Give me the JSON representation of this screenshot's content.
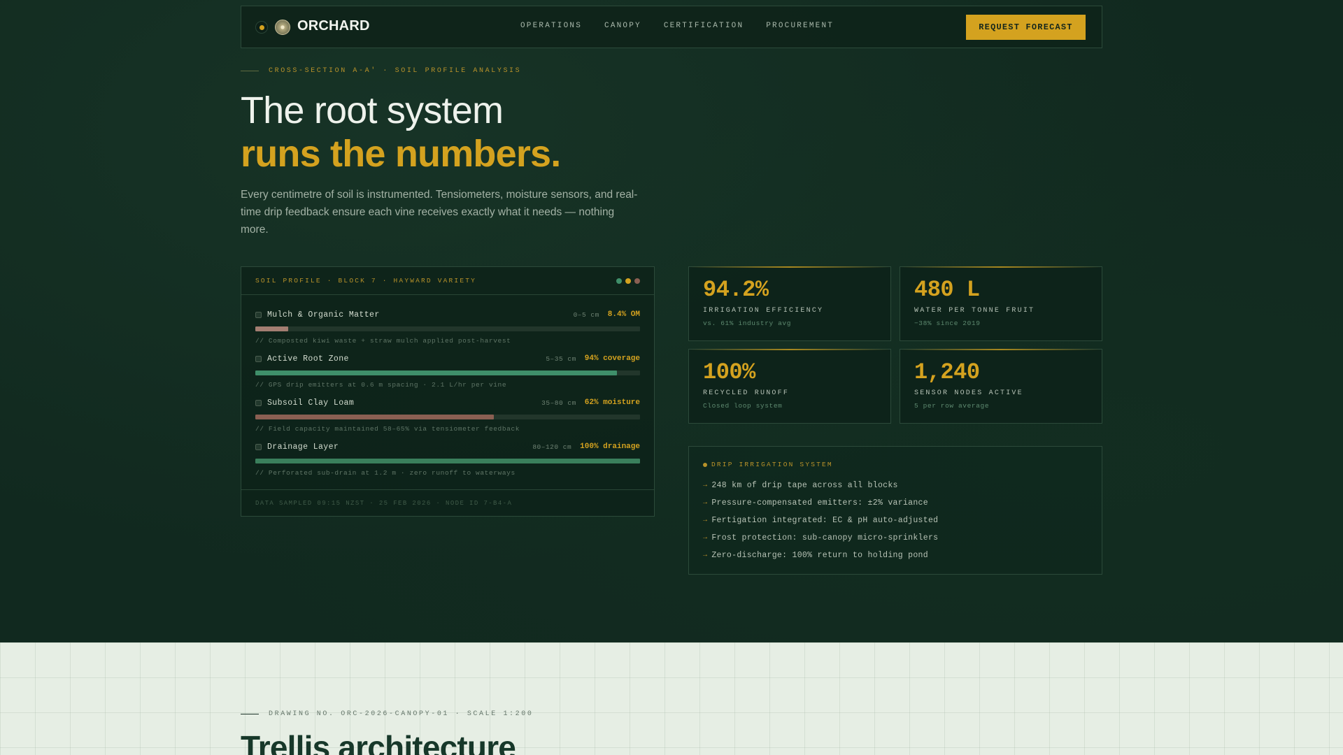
{
  "nav": {
    "brand": "ORCHARD",
    "links": [
      "OPERATIONS",
      "CANOPY",
      "CERTIFICATION",
      "PROCUREMENT"
    ],
    "cta": "REQUEST FORECAST"
  },
  "hero": {
    "eyebrow": "CROSS-SECTION A-A' · SOIL PROFILE ANALYSIS",
    "title_line1": "The root system",
    "title_line2": "runs the numbers.",
    "lede": "Every centimetre of soil is instrumented. Tensiometers, moisture sensors, and real-time drip feedback ensure each vine receives exactly what it needs — nothing more."
  },
  "soil_panel": {
    "title": "SOIL PROFILE · BLOCK 7 · HAYWARD VARIETY",
    "status_dot_colors": [
      "#3f8f6a",
      "#d4a21f",
      "#8a5f52"
    ],
    "layers": [
      {
        "name": "Mulch & Organic Matter",
        "depth": "0–5 cm",
        "value": "8.4% OM",
        "fill_fraction": 0.085,
        "color": "#a37e72",
        "note": "// Composted kiwi waste + straw mulch applied post-harvest"
      },
      {
        "name": "Active Root Zone",
        "depth": "5–35 cm",
        "value": "94% coverage",
        "fill_fraction": 0.94,
        "color": "#3f8f6a",
        "note": "// GPS drip emitters at 0.6 m spacing · 2.1 L/hr per vine"
      },
      {
        "name": "Subsoil Clay Loam",
        "depth": "35–80 cm",
        "value": "62% moisture",
        "fill_fraction": 0.62,
        "color": "#8a5f52",
        "note": "// Field capacity maintained 58–65% via tensiometer feedback"
      },
      {
        "name": "Drainage Layer",
        "depth": "80–120 cm",
        "value": "100% drainage",
        "fill_fraction": 1.0,
        "color": "#3a7f5c",
        "note": "// Perforated sub-drain at 1.2 m · zero runoff to waterways"
      }
    ],
    "footer": "DATA SAMPLED 09:15 NZST · 25 FEB 2026 · NODE ID 7-B4-A"
  },
  "stats": [
    {
      "value": "94.2%",
      "label": "IRRIGATION EFFICIENCY",
      "sub": "vs. 61% industry avg"
    },
    {
      "value": "480 L",
      "label": "WATER PER TONNE FRUIT",
      "sub": "−38% since 2019"
    },
    {
      "value": "100%",
      "label": "RECYCLED RUNOFF",
      "sub": "Closed loop system"
    },
    {
      "value": "1,240",
      "label": "SENSOR NODES ACTIVE",
      "sub": "5 per row average"
    }
  ],
  "drip": {
    "title": "DRIP IRRIGATION SYSTEM",
    "items": [
      "248 km of drip tape across all blocks",
      "Pressure-compensated emitters: ±2% variance",
      "Fertigation integrated: EC & pH auto-adjusted",
      "Frost protection: sub-canopy micro-sprinklers",
      "Zero-discharge: 100% return to holding pond"
    ]
  },
  "section2": {
    "eyebrow": "DRAWING NO. ORC-2026-CANOPY-01 · SCALE 1:200",
    "title": "Trellis architecture"
  },
  "colors": {
    "accent": "#d4a21f",
    "background": "#11291f",
    "light_section": "#e6eee4"
  }
}
